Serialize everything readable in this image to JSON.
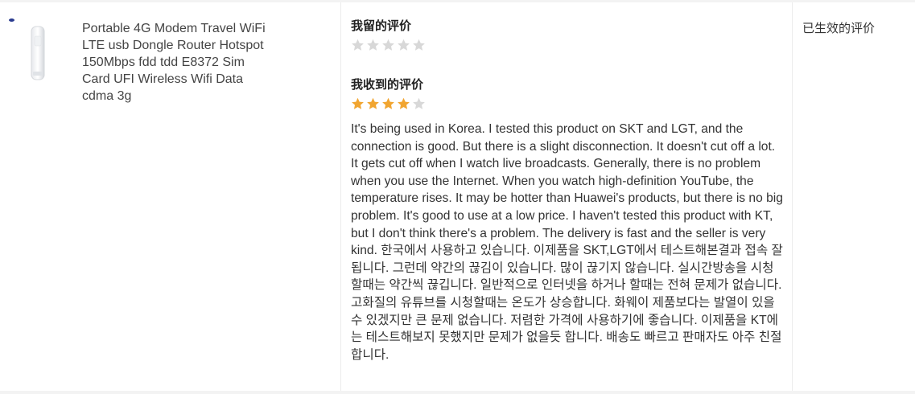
{
  "product": {
    "title": "Portable 4G Modem Travel WiFi LTE usb Dongle Router Hotspot 150Mbps fdd tdd E8372 Sim Card UFI Wireless Wifi Data cdma 3g"
  },
  "my_review": {
    "heading": "我留的评价",
    "rating": 0,
    "max": 5
  },
  "received_review": {
    "heading": "我收到的评价",
    "rating": 4,
    "max": 5,
    "text": "It's being used in Korea. I tested this product on SKT and LGT, and the connection is good. But there is a slight disconnection. It doesn't cut off a lot. It gets cut off when I watch live broadcasts. Generally, there is no problem when you use the Internet. When you watch high-definition YouTube, the temperature rises. It may be hotter than Huawei's products, but there is no big problem. It's good to use at a low price. I haven't tested this product with KT, but I don't think there's a problem. The delivery is fast and the seller is very kind. 한국에서 사용하고 있습니다. 이제품을 SKT,LGT에서 테스트해본결과 접속 잘 됩니다. 그런데 약간의 끊김이 있습니다. 많이 끊기지 않습니다. 실시간방송을 시청할때는 약간씩 끊깁니다. 일반적으로 인터넷을 하거나 할때는 전혀 문제가 없습니다. 고화질의 유튜브를 시청할때는 온도가 상승합니다. 화웨이 제품보다는 발열이 있을수 있겠지만 큰 문제 없습니다. 저렴한 가격에 사용하기에 좋습니다. 이제품을 KT에는 테스트해보지 못했지만 문제가 없을듯 합니다. 배송도 빠르고 판매자도 아주 친절합니다."
  },
  "status": {
    "label": "已生效的评价"
  },
  "colors": {
    "star_on": "#f1a530",
    "star_off": "#d8d8d8",
    "background": "#f3f3f3"
  }
}
